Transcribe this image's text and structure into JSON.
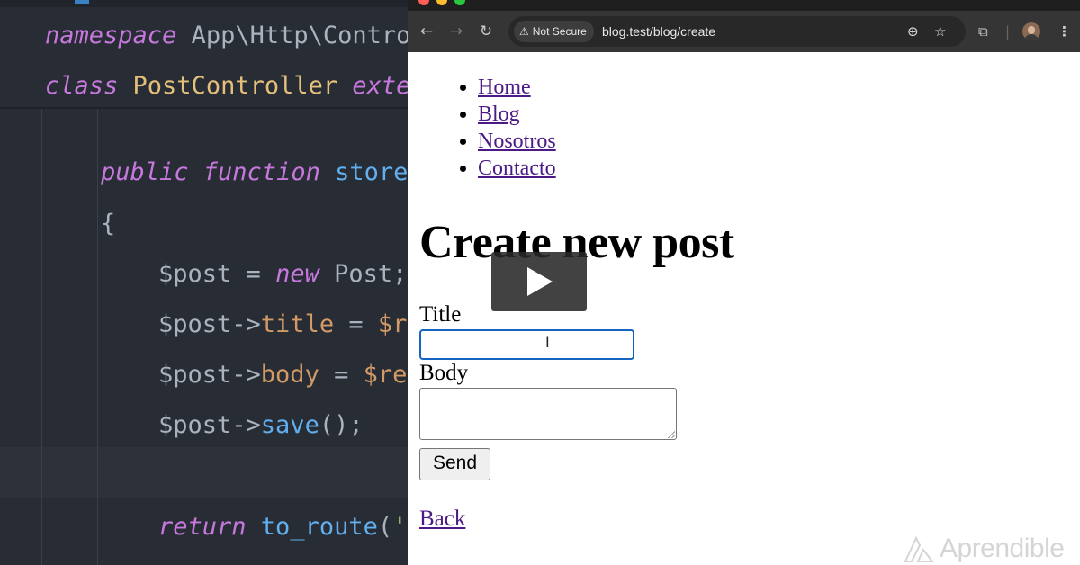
{
  "editor": {
    "lines": {
      "l1": {
        "kw": "namespace",
        "text": " App\\Http\\Control"
      },
      "l2": {
        "kw": "class",
        "cls": " PostController ",
        "kw2": "exter"
      },
      "l3": {
        "kw": "public function",
        "fn": " store",
        "punct": "("
      },
      "l4": {
        "text": "{"
      },
      "l5": {
        "var": "$post",
        "op": " = ",
        "kw": "new",
        "rest": " Post;"
      },
      "l6": {
        "var": "$post",
        "arrow": "->",
        "prop": "title",
        "op": " = ",
        "var2": "$re"
      },
      "l7": {
        "var": "$post",
        "arrow": "->",
        "prop": "body",
        "op": " = ",
        "var2": "$rec"
      },
      "l8": {
        "var": "$post",
        "arrow": "->",
        "fn": "save",
        "rest": "();"
      },
      "l9": {
        "kw": "return",
        "fn": " to_route",
        "punct": "(",
        "str": "'p"
      }
    }
  },
  "browser": {
    "security_label": "Not Secure",
    "url": "blog.test/blog/create",
    "icons": {
      "back": "arrow-left-icon",
      "forward": "arrow-right-icon",
      "reload": "reload-icon",
      "zoom": "zoom-icon",
      "bookmark": "star-icon",
      "extensions": "puzzle-icon",
      "profile": "avatar-icon",
      "menu": "kebab-menu-icon"
    }
  },
  "page": {
    "nav": [
      "Home",
      "Blog",
      "Nosotros",
      "Contacto"
    ],
    "heading": "Create new post",
    "title_label": "Title",
    "title_value": "",
    "body_label": "Body",
    "body_value": "",
    "send_label": "Send",
    "back_label": "Back"
  },
  "overlay": {
    "play_icon": "play-icon",
    "watermark": "Aprendible"
  },
  "colors": {
    "link": "#4b1a86",
    "focus_ring": "#1565c0",
    "editor_bg": "#282c34",
    "keyword": "#c678dd",
    "function": "#61afef",
    "property": "#d19a66",
    "class": "#e5c07b"
  }
}
